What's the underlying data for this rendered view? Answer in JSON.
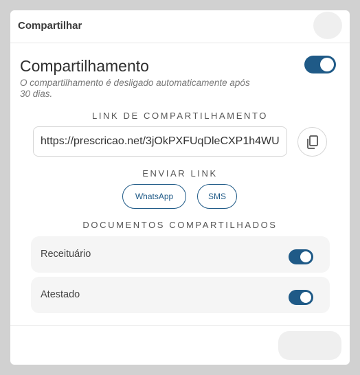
{
  "modal": {
    "title": "Compartilhar"
  },
  "sharing": {
    "title": "Compartilhamento",
    "description": "O compartilhamento é desligado automaticamente após 30 dias.",
    "enabled": true
  },
  "link_section": {
    "label": "LINK DE COMPARTILHAMENTO",
    "url": "https://prescricao.net/3jOkPXFUqDleCXP1h4WU",
    "copy_icon": "copy-icon"
  },
  "send_section": {
    "label": "ENVIAR LINK",
    "buttons": [
      "WhatsApp",
      "SMS"
    ]
  },
  "documents_section": {
    "label": "DOCUMENTOS COMPARTILHADOS",
    "items": [
      {
        "label": "Receituário",
        "enabled": true
      },
      {
        "label": "Atestado",
        "enabled": true
      }
    ]
  },
  "colors": {
    "accent": "#1f5a87",
    "card_bg": "#f5f5f5",
    "backdrop": "#d1d1d1"
  }
}
